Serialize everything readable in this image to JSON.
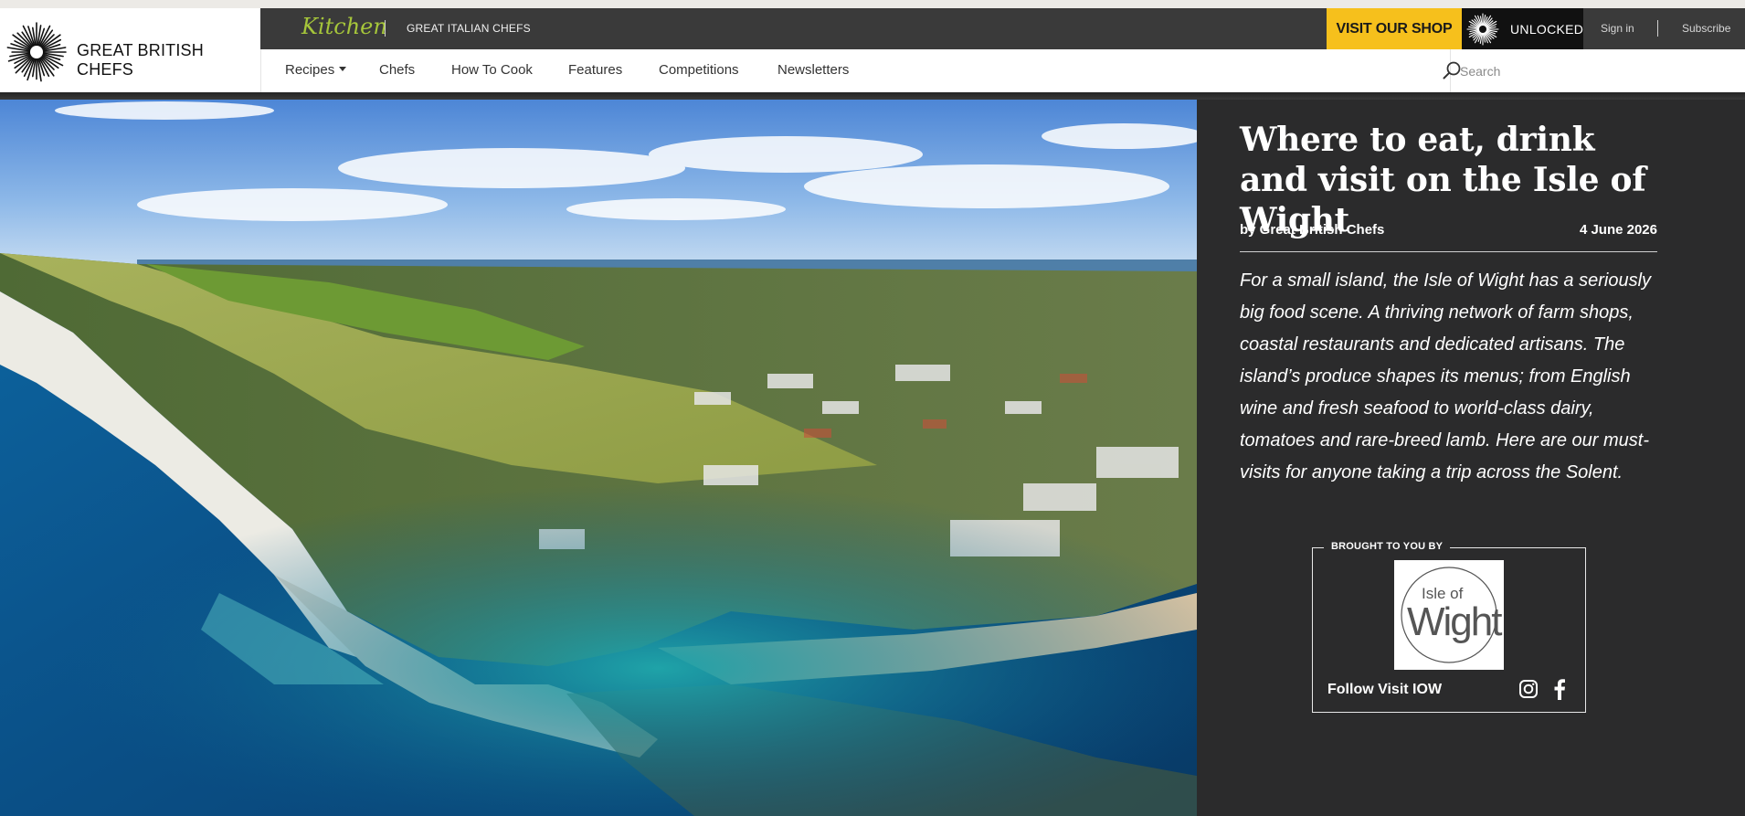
{
  "brand": {
    "name": "GREAT BRITISH CHEFS",
    "kitchen_logo": "Kitchen",
    "sister_site": "GREAT ITALIAN CHEFS"
  },
  "utility_bar": {
    "shop_label": "VISIT OUR SHOP",
    "unlocked_label": "UNLOCKED",
    "signin_label": "Sign in",
    "subscribe_label": "Subscribe"
  },
  "nav": {
    "items": [
      {
        "label": "Recipes"
      },
      {
        "label": "Chefs"
      },
      {
        "label": "How To Cook"
      },
      {
        "label": "Features"
      },
      {
        "label": "Competitions"
      },
      {
        "label": "Newsletters"
      }
    ],
    "search_placeholder": "Search"
  },
  "article": {
    "title": "Where to eat, drink and visit on the Isle of Wight",
    "byline": "by Great British Chefs",
    "date": "4 June 2026",
    "intro": "For a small island, the Isle of Wight has a seriously big food scene. A thriving network of farm shops, coastal restaurants and dedicated artisans. The island’s produce shapes its menus; from English wine and fresh seafood to world-class dairy, tomatoes and rare-breed lamb. Here are our must-visits for anyone taking a trip across the Solent."
  },
  "sponsor": {
    "label": "BROUGHT TO YOU BY",
    "logo_line1": "Isle of",
    "logo_line2": "Wight",
    "follow_text": "Follow Visit IOW",
    "icons": [
      "instagram-icon",
      "facebook-icon"
    ]
  },
  "colors": {
    "utility_bar": "#3a3a3a",
    "shop_button": "#f6c01c",
    "panel": "#2b2b2c",
    "kitchen_green": "#a6c63a"
  }
}
